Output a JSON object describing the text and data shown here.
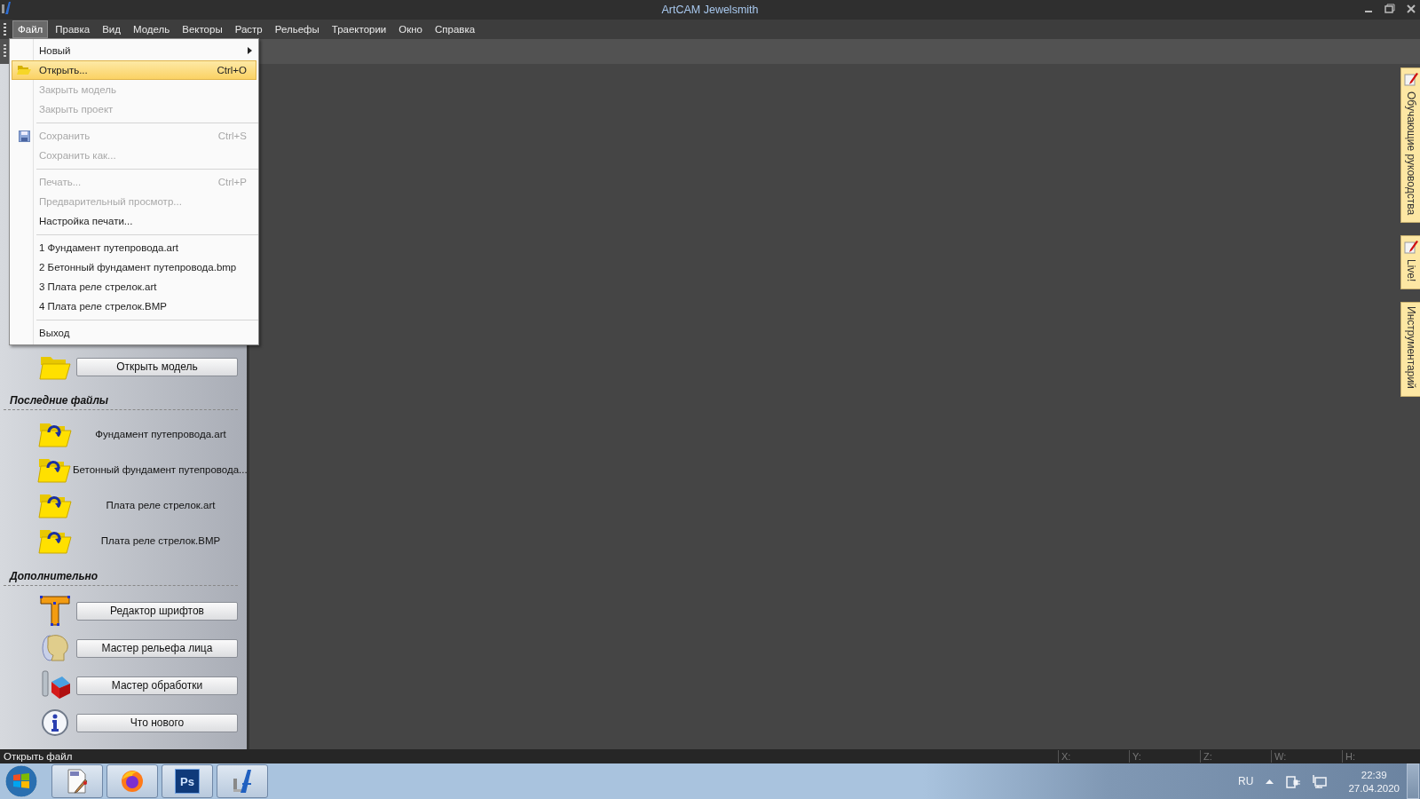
{
  "window": {
    "title": "ArtCAM Jewelsmith"
  },
  "menu_bar": [
    {
      "label": "Файл",
      "selected": true
    },
    {
      "label": "Правка",
      "selected": false
    },
    {
      "label": "Вид",
      "selected": false
    },
    {
      "label": "Модель",
      "selected": false
    },
    {
      "label": "Векторы",
      "selected": false
    },
    {
      "label": "Растр",
      "selected": false
    },
    {
      "label": "Рельефы",
      "selected": false
    },
    {
      "label": "Траектории",
      "selected": false
    },
    {
      "label": "Окно",
      "selected": false
    },
    {
      "label": "Справка",
      "selected": false
    }
  ],
  "file_menu": {
    "items": [
      {
        "kind": "submenu",
        "label": "Новый",
        "disabled": false,
        "selected": false
      },
      {
        "kind": "command",
        "label": "Открыть...",
        "shortcut": "Ctrl+O",
        "disabled": false,
        "selected": true
      },
      {
        "kind": "command",
        "label": "Закрыть модель",
        "disabled": true,
        "selected": false
      },
      {
        "kind": "command",
        "label": "Закрыть проект",
        "disabled": true,
        "selected": false
      },
      {
        "kind": "separator"
      },
      {
        "kind": "command",
        "label": "Сохранить",
        "shortcut": "Ctrl+S",
        "disabled": true,
        "selected": false
      },
      {
        "kind": "command",
        "label": "Сохранить как...",
        "disabled": true,
        "selected": false
      },
      {
        "kind": "separator"
      },
      {
        "kind": "command",
        "label": "Печать...",
        "shortcut": "Ctrl+P",
        "disabled": true,
        "selected": false
      },
      {
        "kind": "command",
        "label": "Предварительный просмотр...",
        "disabled": true,
        "selected": false
      },
      {
        "kind": "command",
        "label": "Настройка печати...",
        "disabled": false,
        "selected": false
      },
      {
        "kind": "separator"
      },
      {
        "kind": "command",
        "label": "1 Фундамент путепровода.art",
        "disabled": false,
        "selected": false
      },
      {
        "kind": "command",
        "label": "2 Бетонный фундамент путепровода.bmp",
        "disabled": false,
        "selected": false
      },
      {
        "kind": "command",
        "label": "3 Плата реле стрелок.art",
        "disabled": false,
        "selected": false
      },
      {
        "kind": "command",
        "label": "4 Плата реле стрелок.BMP",
        "disabled": false,
        "selected": false
      },
      {
        "kind": "separator"
      },
      {
        "kind": "command",
        "label": "Выход",
        "disabled": false,
        "selected": false
      }
    ]
  },
  "start_panel": {
    "open_button": "Открыть модель",
    "recent_heading": "Последние файлы",
    "recent_files": [
      "Фундамент путепровода.art",
      "Бетонный фундамент путепровода...",
      "Плата реле стрелок.art",
      "Плата реле стрелок.BMP"
    ],
    "extras_heading": "Дополнительно",
    "extras": [
      "Редактор шрифтов",
      "Мастер рельефа лица",
      "Мастер обработки",
      "Что нового"
    ]
  },
  "side_tabs": [
    {
      "kind": "icon",
      "label": "Обучающие руководства"
    },
    {
      "kind": "icon",
      "label": "Live!"
    },
    {
      "kind": "plain",
      "label": "Инструментарий"
    }
  ],
  "status_bar": {
    "message": "Открыть файл",
    "fields": [
      "X:",
      "Y:",
      "Z:",
      "W:",
      "H:"
    ]
  },
  "taskbar": {
    "app_icon_text": "Ps",
    "language": "RU",
    "time": "22:39",
    "date": "27.04.2020"
  }
}
